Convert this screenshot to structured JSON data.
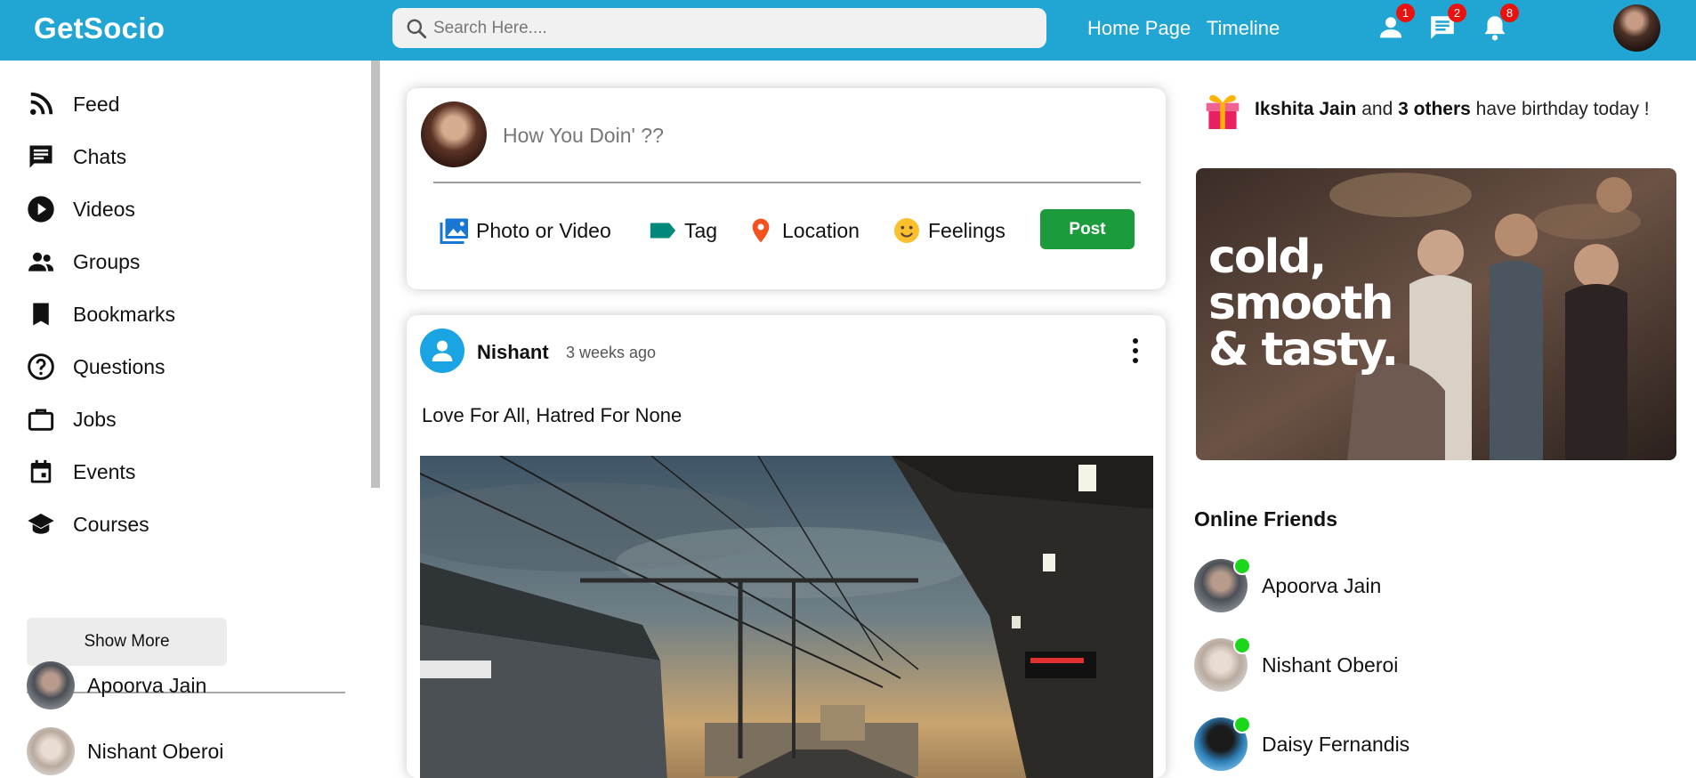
{
  "app": {
    "name": "GetSocio"
  },
  "colors": {
    "brand": "#21a6d4",
    "post_button": "#1c9b3c",
    "badge": "#e8120f",
    "online": "#1bd71b"
  },
  "header": {
    "search_placeholder": "Search Here....",
    "links": [
      "Home Page",
      "Timeline"
    ],
    "icons": [
      {
        "name": "person-icon",
        "badge": "1"
      },
      {
        "name": "chat-icon",
        "badge": "2"
      },
      {
        "name": "notification-bell-icon",
        "badge": "8"
      }
    ]
  },
  "sidebar": {
    "items": [
      {
        "label": "Feed",
        "icon": "rss-feed-icon"
      },
      {
        "label": "Chats",
        "icon": "chat-icon"
      },
      {
        "label": "Videos",
        "icon": "play-circle-icon"
      },
      {
        "label": "Groups",
        "icon": "group-icon"
      },
      {
        "label": "Bookmarks",
        "icon": "bookmark-icon"
      },
      {
        "label": "Questions",
        "icon": "help-circle-icon"
      },
      {
        "label": "Jobs",
        "icon": "briefcase-icon"
      },
      {
        "label": "Events",
        "icon": "calendar-icon"
      },
      {
        "label": "Courses",
        "icon": "school-icon"
      }
    ],
    "show_more": "Show More",
    "friends": [
      "Apoorva Jain",
      "Nishant Oberoi"
    ]
  },
  "share": {
    "placeholder": "How You Doin' ??",
    "options": [
      "Photo or Video",
      "Tag",
      "Location",
      "Feelings"
    ],
    "post_label": "Post"
  },
  "post": {
    "author": "Nishant",
    "time": "3 weeks ago",
    "text": "Love For All, Hatred For None"
  },
  "right": {
    "birthday": {
      "name": "Ikshita Jain",
      "joiner": "and",
      "others": "3 others",
      "suffix": "have birthday today !"
    },
    "ad_text": [
      "cold,",
      "smooth",
      "& tasty."
    ],
    "online_title": "Online Friends",
    "online_friends": [
      "Apoorva Jain",
      "Nishant Oberoi",
      "Daisy Fernandis"
    ]
  }
}
